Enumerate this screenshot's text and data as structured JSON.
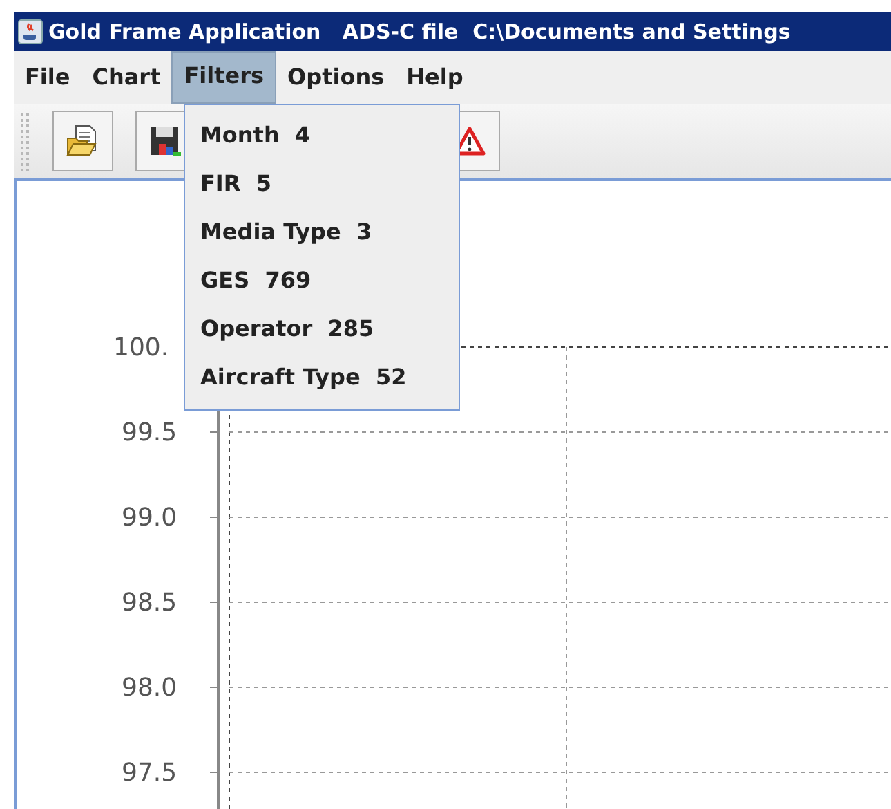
{
  "window": {
    "title": "Gold Frame Application   ADS-C file  C:\\Documents and Settings"
  },
  "menu_bar": [
    {
      "label": "File",
      "selected": false
    },
    {
      "label": "Chart",
      "selected": false
    },
    {
      "label": "Filters",
      "selected": true
    },
    {
      "label": "Options",
      "selected": false
    },
    {
      "label": "Help",
      "selected": false
    }
  ],
  "filters_menu": [
    {
      "label": "Month",
      "count": "4"
    },
    {
      "label": "FIR",
      "count": "5"
    },
    {
      "label": "Media Type",
      "count": "3"
    },
    {
      "label": "GES",
      "count": "769"
    },
    {
      "label": "Operator",
      "count": "285"
    },
    {
      "label": "Aircraft Type",
      "count": "52"
    }
  ],
  "chart": {
    "y_tick_labels": [
      "100.",
      "99.5",
      "99.0",
      "98.5",
      "98.0",
      "97.5"
    ]
  }
}
